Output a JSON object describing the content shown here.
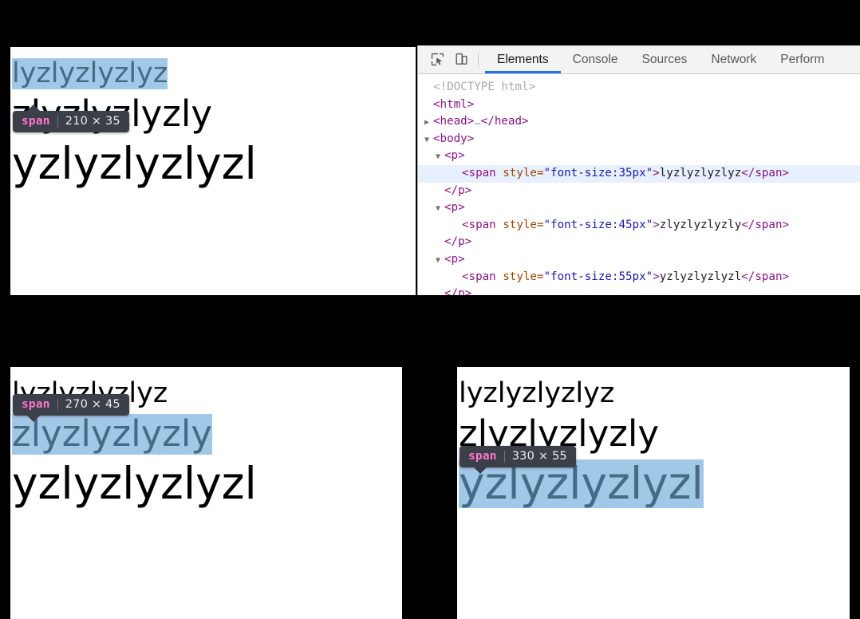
{
  "devtools": {
    "icons": [
      {
        "name": "inspect-element-icon",
        "title": "Inspect element"
      },
      {
        "name": "device-toolbar-icon",
        "title": "Toggle device toolbar"
      }
    ],
    "tabs": [
      {
        "label": "Elements",
        "active": true
      },
      {
        "label": "Console",
        "active": false
      },
      {
        "label": "Sources",
        "active": false
      },
      {
        "label": "Network",
        "active": false
      },
      {
        "label": "Perform",
        "active": false
      }
    ],
    "tree": [
      {
        "indent": 0,
        "triangle": "",
        "doctype": "<!DOCTYPE html>"
      },
      {
        "indent": 0,
        "triangle": "",
        "tag_open": "<html>"
      },
      {
        "indent": 0,
        "triangle": "▶",
        "tag_open": "<head>",
        "ellipsis": "…",
        "tag_close": "</head>"
      },
      {
        "indent": 0,
        "triangle": "▼",
        "tag_open": "<body>"
      },
      {
        "indent": 1,
        "triangle": "▼",
        "tag_open": "<p>"
      },
      {
        "indent": 2,
        "triangle": "",
        "selected": true,
        "span_open_a": "<span",
        "attr": " style",
        "eq": "=",
        "val": "\"font-size:35px\"",
        "span_open_b": ">",
        "text": "lyzlyzlyzlyz",
        "span_close": "</span>"
      },
      {
        "indent": 1,
        "triangle": "",
        "tag_close_only": "</p>"
      },
      {
        "indent": 1,
        "triangle": "▼",
        "tag_open": "<p>"
      },
      {
        "indent": 2,
        "triangle": "",
        "selected": false,
        "span_open_a": "<span",
        "attr": " style",
        "eq": "=",
        "val": "\"font-size:45px\"",
        "span_open_b": ">",
        "text": "zlyzlyzlyzly",
        "span_close": "</span>"
      },
      {
        "indent": 1,
        "triangle": "",
        "tag_close_only": "</p>"
      },
      {
        "indent": 1,
        "triangle": "▼",
        "tag_open": "<p>"
      },
      {
        "indent": 2,
        "triangle": "",
        "selected": false,
        "span_open_a": "<span",
        "attr": " style",
        "eq": "=",
        "val": "\"font-size:55px\"",
        "span_open_b": ">",
        "text": "yzlyzlyzlyzl",
        "span_close": "</span>"
      },
      {
        "indent": 1,
        "triangle": "",
        "tag_close_only": "</p>"
      }
    ]
  },
  "panels": {
    "top_left": {
      "badge": {
        "tag": "span",
        "dimensions": "210 × 35"
      },
      "lines": [
        {
          "text": "lyzlyzlyzlyz",
          "font_px": 35,
          "highlighted": true
        },
        {
          "text": "zlyzlyzlyzly",
          "font_px": 45,
          "highlighted": false
        },
        {
          "text": "yzlyzlyzlyzl",
          "font_px": 55,
          "highlighted": false
        }
      ]
    },
    "bottom_left": {
      "badge": {
        "tag": "span",
        "dimensions": "270 × 45"
      },
      "lines": [
        {
          "text": "lyzlyzlyzlyz",
          "font_px": 35,
          "highlighted": false
        },
        {
          "text": "zlyzlyzlyzly",
          "font_px": 45,
          "highlighted": true
        },
        {
          "text": "yzlyzlyzlyzl",
          "font_px": 55,
          "highlighted": false
        }
      ]
    },
    "bottom_right": {
      "badge": {
        "tag": "span",
        "dimensions": "330 × 55"
      },
      "lines": [
        {
          "text": "lyzlyzlyzlyz",
          "font_px": 35,
          "highlighted": false
        },
        {
          "text": "zlyzlyzlyzly",
          "font_px": 45,
          "highlighted": false
        },
        {
          "text": "yzlyzlyzlyzl",
          "font_px": 55,
          "highlighted": true
        }
      ]
    }
  },
  "colors": {
    "highlight_bg": "#a2c8e8",
    "badge_bg": "#3b3f47",
    "badge_tag": "#ff75d1",
    "tab_accent": "#1a73e8",
    "backdrop": "#000000"
  }
}
